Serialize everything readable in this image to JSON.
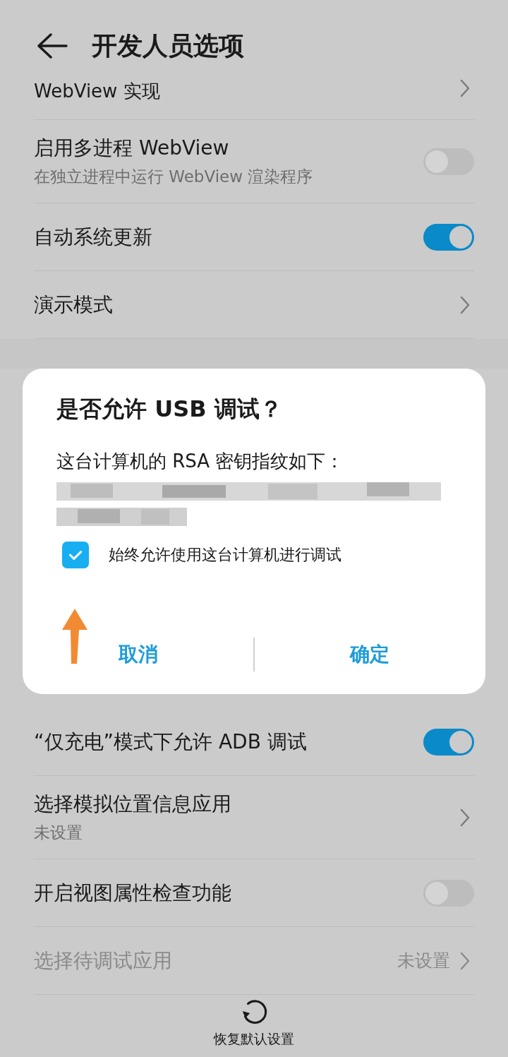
{
  "header": {
    "title": "开发人员选项"
  },
  "settings_above": [
    {
      "kind": "link",
      "title": "WebView 实现",
      "disabled": false
    },
    {
      "kind": "toggle",
      "title": "启用多进程 WebView",
      "subtitle": "在独立进程中运行 WebView 渲染程序",
      "on": false,
      "disabled": false
    },
    {
      "kind": "toggle",
      "title": "自动系统更新",
      "on": true,
      "disabled": false
    },
    {
      "kind": "link",
      "title": "演示模式",
      "disabled": false
    }
  ],
  "dialog": {
    "title": "是否允许 USB 调试？",
    "message": "这台计算机的 RSA 密钥指纹如下：",
    "checkbox": {
      "label": "始终允许使用这台计算机进行调试",
      "checked": true
    },
    "buttons": [
      "取消",
      "确定"
    ]
  },
  "settings_below": [
    {
      "kind": "toggle",
      "title": "“仅充电”模式下允许 ADB 调试",
      "on": true,
      "disabled": false
    },
    {
      "kind": "link",
      "title": "选择模拟位置信息应用",
      "subtitle": "未设置",
      "disabled": false
    },
    {
      "kind": "toggle",
      "title": "开启视图属性检查功能",
      "on": false,
      "disabled": false
    },
    {
      "kind": "link",
      "title": "选择待调试应用",
      "value": "未设置",
      "disabled": true
    }
  ],
  "bottom_action": {
    "label": "恢复默认设置"
  }
}
